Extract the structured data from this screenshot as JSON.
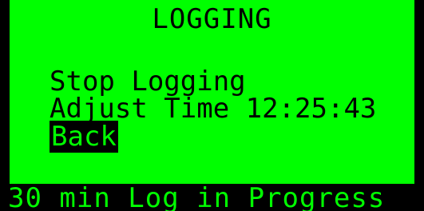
{
  "screen": {
    "title": "LOGGING",
    "menu": {
      "stop_logging": "Stop Logging",
      "adjust_time": "Adjust Time 12:25:43",
      "back": "Back"
    },
    "selected_item": "Back"
  },
  "status": {
    "text": "30 min Log in Progress"
  },
  "colors": {
    "lcd_green": "#00ff00",
    "background": "#000000"
  }
}
